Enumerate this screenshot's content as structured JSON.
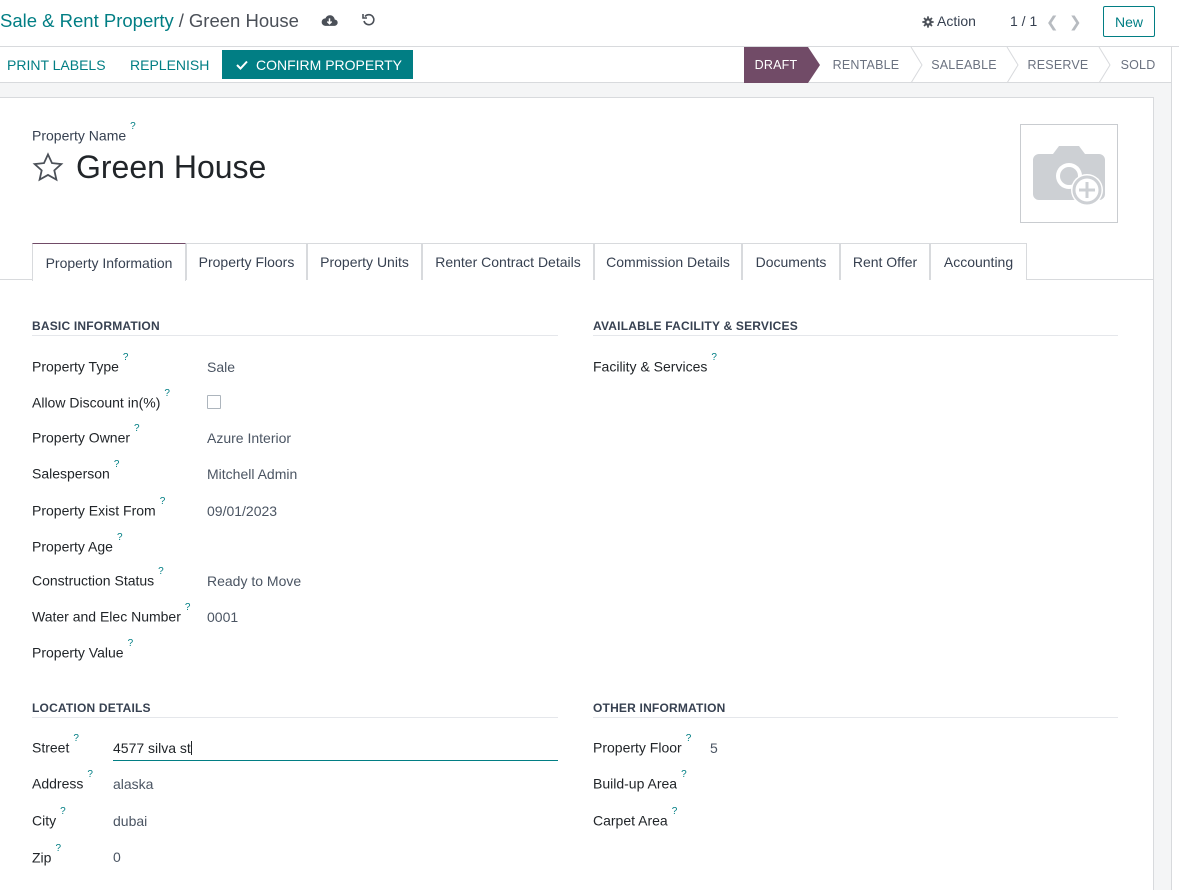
{
  "breadcrumb": {
    "parent": "Sale & Rent Property",
    "separator": "/",
    "current": "Green House"
  },
  "control": {
    "action_label": "Action",
    "pager": "1 / 1",
    "new_label": "New"
  },
  "buttons": {
    "print_labels": "PRINT LABELS",
    "replenish": "REPLENISH",
    "confirm": "CONFIRM PROPERTY"
  },
  "status": {
    "draft": "DRAFT",
    "rentable": "RENTABLE",
    "saleable": "SALEABLE",
    "reserve": "RESERVE",
    "sold": "SOLD",
    "active": "DRAFT"
  },
  "record": {
    "name_label": "Property Name",
    "name": "Green House",
    "help": "?"
  },
  "tabs": [
    "Property Information",
    "Property Floors",
    "Property Units",
    "Renter Contract Details",
    "Commission Details",
    "Documents",
    "Rent Offer",
    "Accounting"
  ],
  "basic": {
    "title": "BASIC INFORMATION",
    "property_type_label": "Property Type",
    "property_type": "Sale",
    "allow_discount_label": "Allow Discount in(%)",
    "allow_discount": false,
    "owner_label": "Property Owner",
    "owner": "Azure Interior",
    "salesperson_label": "Salesperson",
    "salesperson": "Mitchell Admin",
    "exist_from_label": "Property Exist From",
    "exist_from": "09/01/2023",
    "age_label": "Property Age",
    "age": "",
    "construction_label": "Construction Status",
    "construction": "Ready to Move",
    "water_label": "Water and Elec Number",
    "water": "0001",
    "value_label": "Property Value",
    "value": ""
  },
  "facility": {
    "title": "AVAILABLE FACILITY & SERVICES",
    "label": "Facility & Services"
  },
  "location": {
    "title": "LOCATION DETAILS",
    "street_label": "Street",
    "street": "4577 silva st",
    "address_label": "Address",
    "address": "alaska",
    "city_label": "City",
    "city": "dubai",
    "zip_label": "Zip",
    "zip": "0"
  },
  "other": {
    "title": "OTHER INFORMATION",
    "floor_label": "Property Floor",
    "floor": "5",
    "buildup_label": "Build-up Area",
    "carpet_label": "Carpet Area"
  },
  "colors": {
    "brand": "#017e84",
    "status_active": "#714b67"
  }
}
